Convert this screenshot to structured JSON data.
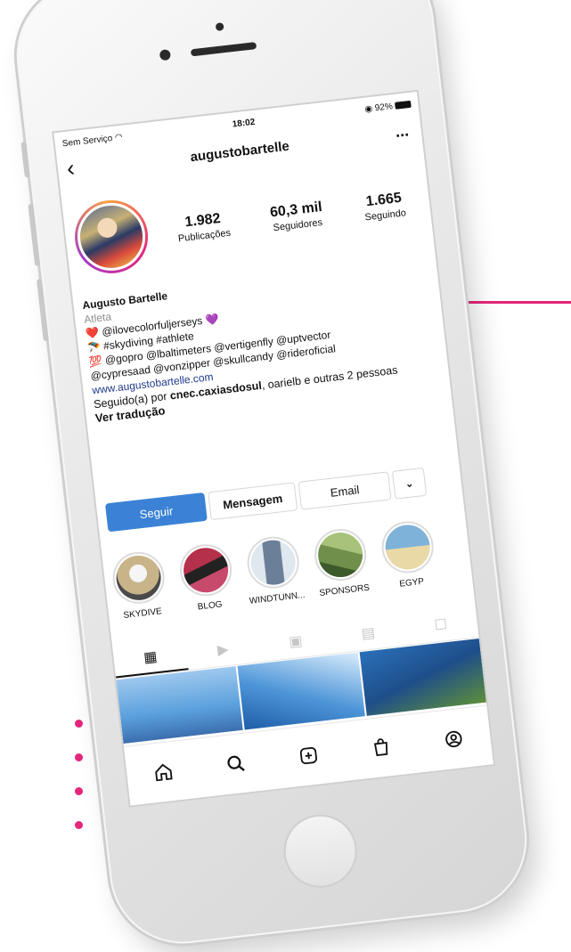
{
  "status_bar": {
    "carrier": "Sem Serviço",
    "time": "18:02",
    "battery": "92%"
  },
  "header": {
    "back_icon": "chevron-left-icon",
    "username": "augustobartelle",
    "more_label": "..."
  },
  "stats": [
    {
      "number": "1.982",
      "label": "Publicações"
    },
    {
      "number": "60,3 mil",
      "label": "Seguidores"
    },
    {
      "number": "1.665",
      "label": "Seguindo"
    }
  ],
  "bio": {
    "name": "Augusto Bartelle",
    "category": "Atleta",
    "lines": [
      "❤️ @ilovecolorfuljerseys 💜",
      "🪂 #skydiving #athlete",
      "💯 @gopro @lbaltimeters @vertigenfly @uptvector",
      "@cypresaad @vonzipper @skullcandy @rideroficial"
    ],
    "website": "www.augustobartelle.com",
    "followed_prefix": "Seguido(a) por ",
    "followed_names": "cnec.caxiasdosul",
    "followed_suffix": ", oarielb e outras 2 pessoas",
    "translate": "Ver tradução"
  },
  "actions": {
    "follow": "Seguir",
    "message": "Mensagem",
    "email": "Email",
    "dropdown": "⌄"
  },
  "highlights": [
    {
      "label": "SKYDIVE",
      "color": "#c9b48a"
    },
    {
      "label": "BLOG",
      "color": "#b5304a"
    },
    {
      "label": "WINDTUNN...",
      "color": "#6b7f99"
    },
    {
      "label": "SPONSORS",
      "color": "#6f8f4a"
    },
    {
      "label": "EGYP",
      "color": "#7fb2d9"
    }
  ],
  "tabs": [
    "grid-icon",
    "reels-icon",
    "igtv-icon",
    "guides-icon",
    "tagged-icon"
  ],
  "colors": {
    "accent": "#e4267b",
    "follow_button": "#3b82d6",
    "link": "#1f3a8a"
  }
}
